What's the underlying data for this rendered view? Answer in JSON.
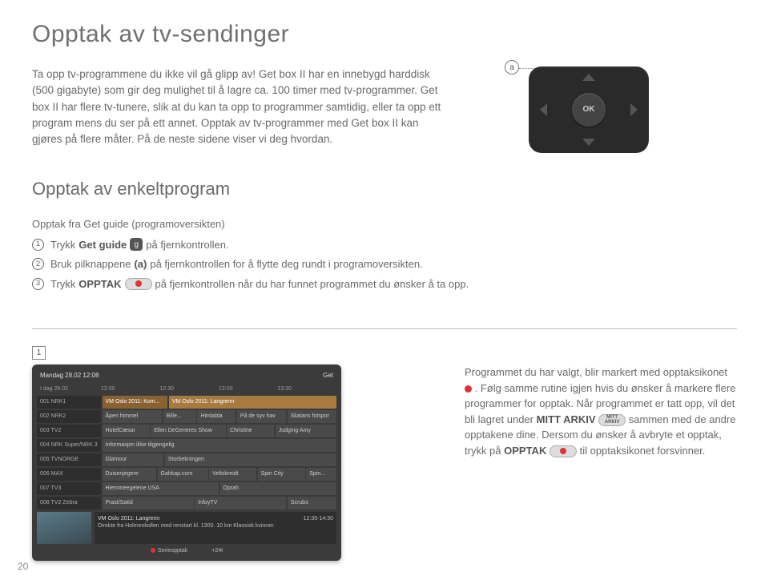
{
  "title": "Opptak av tv-sendinger",
  "intro": "Ta opp tv-programmene du ikke vil gå glipp av! Get box II har en innebygd harddisk (500 gigabyte) som gir deg mulighet til å lagre ca. 100 timer med tv-programmer. Get box II har flere tv-tunere, slik at du kan ta opp to programmer samtidig, eller ta opp ett program mens du ser på ett annet. Opptak av tv-programmer med Get box II kan gjøres på flere måter. På de neste sidene viser vi deg hvordan.",
  "remote_ref": "a",
  "remote_ok": "OK",
  "section2_title": "Opptak av enkeltprogram",
  "subheading": "Opptak fra Get guide (programoversikten)",
  "step1_a": "Trykk ",
  "step1_b": "Get guide",
  "step1_c": " på fjernkontrollen.",
  "icon_g": "g",
  "step2_a": "Bruk pilknappene ",
  "step2_b": "(a)",
  "step2_c": " på fjernkontrollen for å flytte deg rundt i programoversikten.",
  "step3_a": "Trykk ",
  "step3_b": "OPPTAK",
  "step3_c": " på fjernkontrollen når du har funnet programmet du ønsker å ta opp.",
  "guide_ref": "1",
  "epg_header": "Mandag 28.02 12:08",
  "epg_brand": "Get",
  "epg_times_label": "I dag 28.02",
  "epg_times": [
    "12:00",
    "12:30",
    "13:00",
    "13:30"
  ],
  "epg_channels": [
    "001 NRK1",
    "002 NRK2",
    "003 TV2",
    "004 NRK Super/NRK 3",
    "005 TVNORGE",
    "006 MAX",
    "007 TV3",
    "008 TV2 Zebra"
  ],
  "epg_r1": [
    "VM Oslo 2011: Kom...",
    "VM Oslo 2011: Langrenn"
  ],
  "epg_r2": [
    "Åpen himmel",
    "Bille...",
    "Himlabla",
    "På de syv hav",
    "Sliatans fotspor"
  ],
  "epg_r3": [
    "HotelCæsar",
    "Ellen DeGeneres Show",
    "Christine",
    "Judging Amy"
  ],
  "epg_r4": [
    "Informasjon ikke tilgjengelig"
  ],
  "epg_r5": [
    "Glamour",
    "Storbekningen"
  ],
  "epg_r6": [
    "Duisenjegere",
    "Gahkap.com",
    "Veltskreidt",
    "Spin City",
    "Spin..."
  ],
  "epg_r7": [
    "Hiemmeegelene USA",
    "Oprah"
  ],
  "epg_r8": [
    "Prast/Satid",
    "InfoyTV",
    "Scrubs"
  ],
  "epg_desc_title": "VM Oslo 2011: Langrenn",
  "epg_desc_time": "12:35-14:30",
  "epg_desc_body": "Direkte fra Holmenkollen med renstart kl. 1300. 10 km Klassisk kvinner.",
  "epg_bottom_a": "Serieopptak",
  "epg_bottom_b": "+24t",
  "rt_1": "Programmet du har valgt, blir markert med opptaksikonet ",
  "rt_2": ". Følg samme rutine igjen hvis du ønsker å markere flere programmer for opptak. Når programmet er tatt opp, vil det bli lagret under ",
  "rt_mitt": "MITT ARKIV",
  "rt_3": " sammen med de andre opptakene dine. Dersom du ønsker å avbryte et opptak, trykk på ",
  "rt_opptak": "OPPTAK",
  "rt_4": " til opptaksikonet forsvinner.",
  "arkiv_label": "MITT ARKIV",
  "page_num": "20"
}
